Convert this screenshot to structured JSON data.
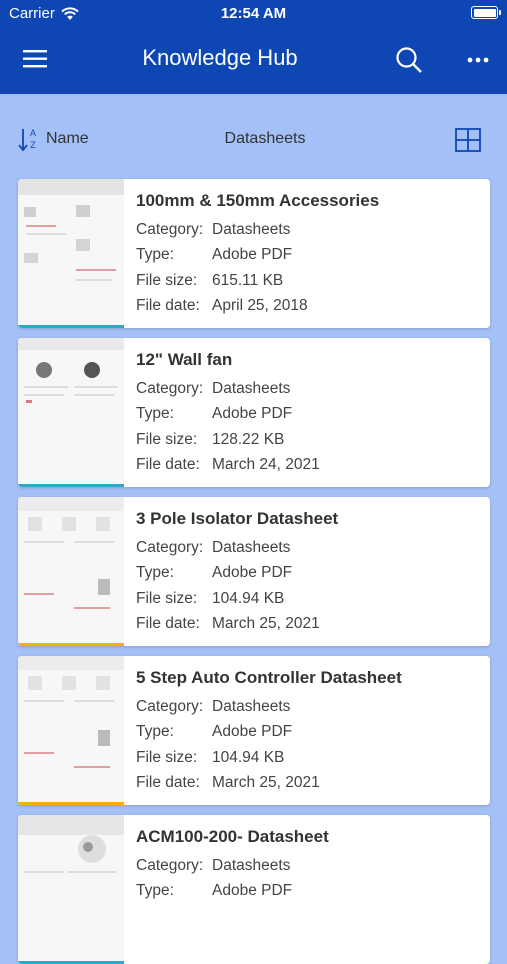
{
  "status_bar": {
    "carrier": "Carrier",
    "time": "12:54 AM"
  },
  "nav": {
    "title": "Knowledge Hub"
  },
  "toolbar": {
    "sort_label": "Name",
    "filter_label": "Datasheets"
  },
  "labels": {
    "category": "Category:",
    "type": "Type:",
    "size": "File size:",
    "date": "File date:"
  },
  "colors": {
    "nav_bg": "#0e47b3",
    "page_bg": "#a3c1f6"
  },
  "icons": [
    "wifi-icon",
    "battery-icon",
    "menu-icon",
    "search-icon",
    "more-icon",
    "sort-icon",
    "grid-view-icon"
  ],
  "documents": [
    {
      "title": "100mm & 150mm Accessories",
      "category": "Datasheets",
      "type": "Adobe PDF",
      "size": "615.11 KB",
      "date": "April 25, 2018",
      "thumb_accent": "#2aa9c9"
    },
    {
      "title": "12\" Wall fan",
      "category": "Datasheets",
      "type": "Adobe PDF",
      "size": "128.22 KB",
      "date": "March 24, 2021",
      "thumb_accent": "#2aa9c9"
    },
    {
      "title": "3 Pole Isolator Datasheet",
      "category": "Datasheets",
      "type": "Adobe PDF",
      "size": "104.94 KB",
      "date": "March 25, 2021",
      "thumb_accent": "#f0b400"
    },
    {
      "title": "5 Step Auto Controller Datasheet",
      "category": "Datasheets",
      "type": "Adobe PDF",
      "size": "104.94 KB",
      "date": "March 25, 2021",
      "thumb_accent": "#f0b400"
    },
    {
      "title": "ACM100-200- Datasheet",
      "category": "Datasheets",
      "type": "Adobe PDF",
      "size": "",
      "date": "",
      "thumb_accent": "#2aa9c9"
    }
  ]
}
